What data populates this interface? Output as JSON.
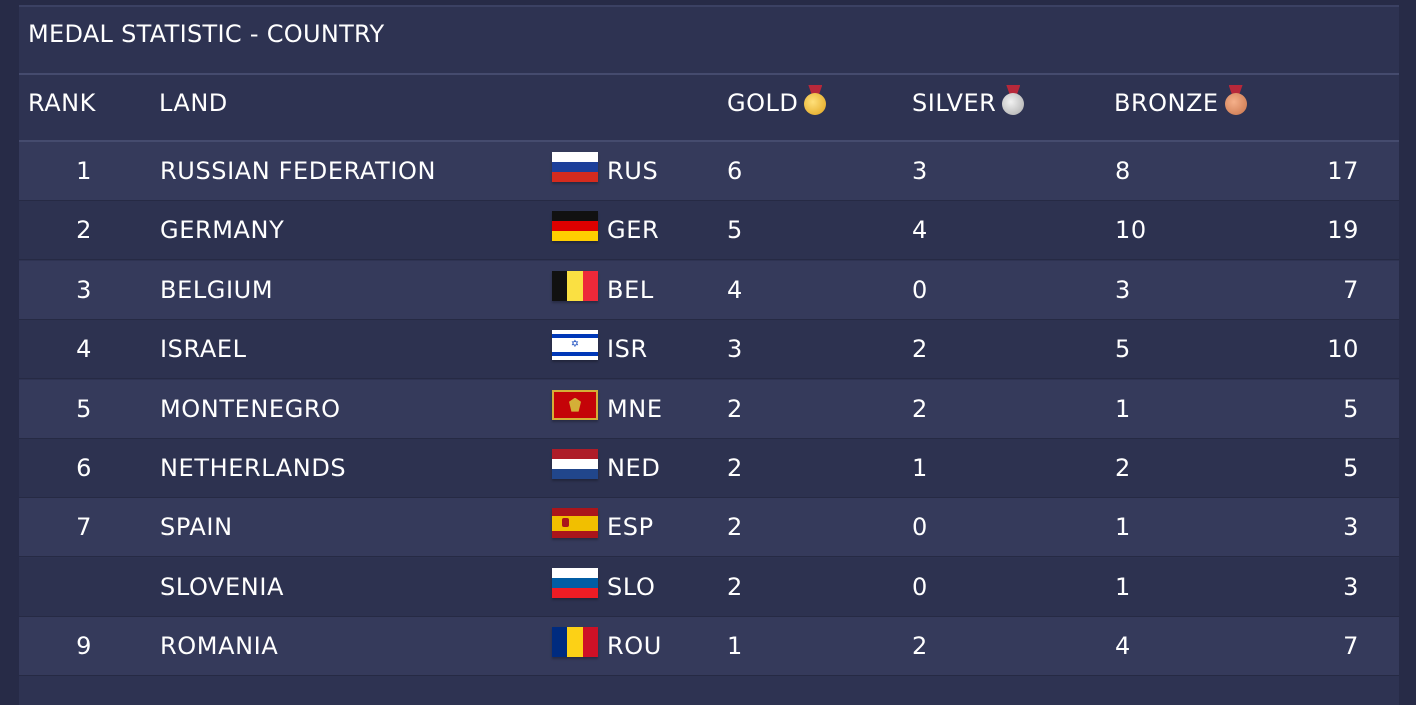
{
  "title": "MEDAL STATISTIC - COUNTRY",
  "columns": {
    "rank": "RANK",
    "land": "LAND",
    "gold": "GOLD",
    "silver": "SILVER",
    "bronze": "BRONZE"
  },
  "medal_icons": [
    "gold-medal-icon",
    "silver-medal-icon",
    "bronze-medal-icon"
  ],
  "rows": [
    {
      "rank": "1",
      "land": "RUSSIAN FEDERATION",
      "code": "RUS",
      "gold": "6",
      "silver": "3",
      "bronze": "8",
      "total": "17",
      "flag": {
        "orientation": "h",
        "colors": [
          "#ffffff",
          "#1c3f9a",
          "#d52b1e"
        ]
      }
    },
    {
      "rank": "2",
      "land": "GERMANY",
      "code": "GER",
      "gold": "5",
      "silver": "4",
      "bronze": "10",
      "total": "19",
      "flag": {
        "orientation": "h",
        "colors": [
          "#111111",
          "#dd0000",
          "#ffce00"
        ]
      }
    },
    {
      "rank": "3",
      "land": "BELGIUM",
      "code": "BEL",
      "gold": "4",
      "silver": "0",
      "bronze": "3",
      "total": "7",
      "flag": {
        "orientation": "v",
        "colors": [
          "#111111",
          "#fae042",
          "#ed2939"
        ]
      }
    },
    {
      "rank": "4",
      "land": "ISRAEL",
      "code": "ISR",
      "gold": "3",
      "silver": "2",
      "bronze": "5",
      "total": "10",
      "flag": {
        "orientation": "special",
        "name": "israel"
      }
    },
    {
      "rank": "5",
      "land": "MONTENEGRO",
      "code": "MNE",
      "gold": "2",
      "silver": "2",
      "bronze": "1",
      "total": "5",
      "flag": {
        "orientation": "special",
        "name": "montenegro"
      }
    },
    {
      "rank": "6",
      "land": "NETHERLANDS",
      "code": "NED",
      "gold": "2",
      "silver": "1",
      "bronze": "2",
      "total": "5",
      "flag": {
        "orientation": "h",
        "colors": [
          "#ae1c28",
          "#ffffff",
          "#21468b"
        ]
      }
    },
    {
      "rank": "7",
      "land": "SPAIN",
      "code": "ESP",
      "gold": "2",
      "silver": "0",
      "bronze": "1",
      "total": "3",
      "flag": {
        "orientation": "special",
        "name": "spain"
      }
    },
    {
      "rank": "",
      "land": "SLOVENIA",
      "code": "SLO",
      "gold": "2",
      "silver": "0",
      "bronze": "1",
      "total": "3",
      "flag": {
        "orientation": "h",
        "colors": [
          "#ffffff",
          "#005da4",
          "#ed1c24"
        ]
      }
    },
    {
      "rank": "9",
      "land": "ROMANIA",
      "code": "ROU",
      "gold": "1",
      "silver": "2",
      "bronze": "4",
      "total": "7",
      "flag": {
        "orientation": "v",
        "colors": [
          "#002b7f",
          "#fcd116",
          "#ce1126"
        ]
      }
    }
  ]
}
